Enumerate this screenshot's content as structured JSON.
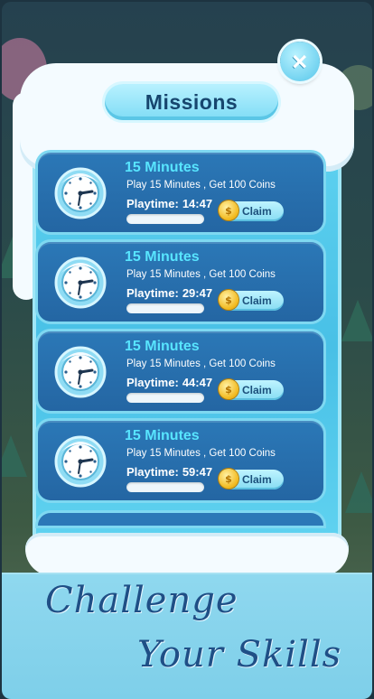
{
  "header": {
    "title": "Missions",
    "close_icon": "close-icon"
  },
  "missions": [
    {
      "title": "15 Minutes",
      "description": "Play 15 Minutes , Get 100 Coins",
      "playtime_label": "Playtime:",
      "playtime_value": "14:47",
      "claim_label": "Claim",
      "progress": 0,
      "icon": "clock-icon"
    },
    {
      "title": "15 Minutes",
      "description": "Play 15 Minutes , Get 100 Coins",
      "playtime_label": "Playtime:",
      "playtime_value": "29:47",
      "claim_label": "Claim",
      "progress": 0,
      "icon": "clock-icon"
    },
    {
      "title": "15 Minutes",
      "description": "Play 15 Minutes , Get 100 Coins",
      "playtime_label": "Playtime:",
      "playtime_value": "44:47",
      "claim_label": "Claim",
      "progress": 0,
      "icon": "clock-icon"
    },
    {
      "title": "15 Minutes",
      "description": "Play 15 Minutes , Get 100 Coins",
      "playtime_label": "Playtime:",
      "playtime_value": "59:47",
      "claim_label": "Claim",
      "progress": 0,
      "icon": "clock-icon"
    }
  ],
  "banner": {
    "line1": "Challenge",
    "line2": "Your Skills"
  },
  "colors": {
    "card": "#2466a3",
    "title_accent": "#58e5ff",
    "ice": "#5fd2f0",
    "banner": "#8fd8ef",
    "banner_text": "#1f4f86"
  }
}
